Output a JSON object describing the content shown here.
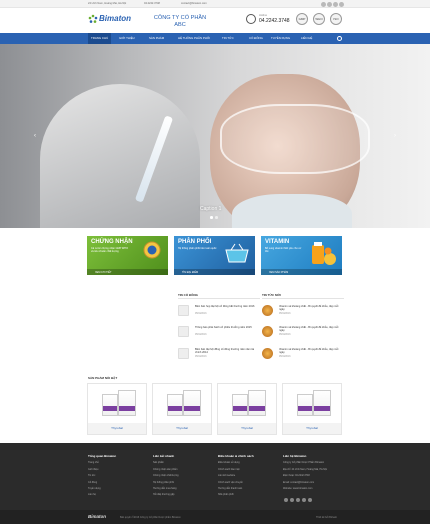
{
  "topbar": {
    "address": "24 Lĩnh Nam, Hoàng Mai, Hà Nội",
    "phone": "04.2242.3748",
    "email": "contact@bimaton.com"
  },
  "header": {
    "logo": "Bimaton",
    "company_line1": "CÔNG TY CỔ PHẦN",
    "company_line2": "ABC",
    "hotline_label": "Hotline",
    "hotline": "04.2242.3748",
    "certs": [
      "GMP",
      "WHO",
      "ISO"
    ]
  },
  "nav": {
    "items": [
      "Trang chủ",
      "Giới thiệu",
      "Sản phẩm",
      "Hệ thống phân phối",
      "Tin tức",
      "Cổ đông",
      "Tuyển dụng",
      "Liên hệ"
    ],
    "active_index": 0,
    "search_icon": "search-icon"
  },
  "hero": {
    "caption": "Caption 1"
  },
  "banners": [
    {
      "title": "CHỨNG NHẬN",
      "sub": "Cả nước chứng nhận GMP WHO và tiêu chuẩn chất lượng",
      "link": "XEM CHI TIẾT",
      "color": "#6aae2f"
    },
    {
      "title": "PHÂN PHỐI",
      "sub": "Hệ thống phân phối trên toàn quốc",
      "link": "TÌM ĐẠI ĐIỂM",
      "color": "#2c7fc4"
    },
    {
      "title": "VITAMIN",
      "sub": "Bổ sung vitamin thiết yếu cho cơ thể",
      "link": "XEM SẢN PHẨM",
      "color": "#2a9ad8"
    }
  ],
  "news": {
    "shareholders": {
      "title": "TIN CỔ ĐÔNG",
      "items": [
        {
          "title": "Biên bản họp đại hội cổ đông bất thường năm 2016",
          "date": "05/04/2016"
        },
        {
          "title": "Thông báo phát hành cổ phiếu thưởng năm 2015",
          "date": "05/04/2016"
        },
        {
          "title": "Biên bản đại hội đồng cổ đông thường niên năm tài chính 2014",
          "date": "05/04/2016"
        }
      ]
    },
    "latest": {
      "title": "TIN TỨC MỚI",
      "items": [
        {
          "title": "Vitamin và khoáng chất - Bí quyết để khỏe, đẹp mỗi ngày",
          "date": "05/04/2016"
        },
        {
          "title": "Vitamin và khoáng chất - Bí quyết để khỏe, đẹp mỗi ngày",
          "date": "05/04/2016"
        },
        {
          "title": "Vitamin và khoáng chất - Bí quyết để khỏe, đẹp mỗi ngày",
          "date": "05/04/2016"
        }
      ]
    }
  },
  "products": {
    "title": "SẢN PHẨM NỔI BẬT",
    "items": [
      "Thyrobal",
      "Thyrobal",
      "Thyrobal",
      "Thyrobal"
    ]
  },
  "footer": {
    "columns": [
      {
        "title": "Tổng quan Bimaton",
        "links": [
          "Trang chủ",
          "Giới thiệu",
          "Tin tức",
          "Cổ đông",
          "Tuyển dụng",
          "Liên hệ"
        ]
      },
      {
        "title": "Liên kết nhanh",
        "links": [
          "Sản phẩm",
          "Chứng nhận sản phẩm",
          "Chứng nhận chất lượng",
          "Hệ thống phân phối",
          "Hướng dẫn mua hàng",
          "Hỏi đáp thường gặp"
        ]
      },
      {
        "title": "Điều khoản & chính sách",
        "links": [
          "Điều khoản sử dụng",
          "Chính sách bảo mật",
          "Liên kết website",
          "Chính sách vận chuyển",
          "Hướng dẫn thanh toán",
          "Nhà phân phối"
        ]
      },
      {
        "title": "Liên hệ Bimaton",
        "links": [
          "Công ty Cổ phần Dược Phẩm Bimaton",
          "Địa chỉ: 24 Lĩnh Nam, Hoàng Mai, Hà Nội",
          "Điện thoại: 04.2242.3748",
          "Email: contact@bimaton.com",
          "Website: www.bimaton.com"
        ]
      }
    ],
    "logo": "Bimaton",
    "copyright": "Bản quyền ©2016 Công ty Cổ phần Dược phẩm Bimaton",
    "developer": "Thiết kế bởi Bizweb"
  }
}
